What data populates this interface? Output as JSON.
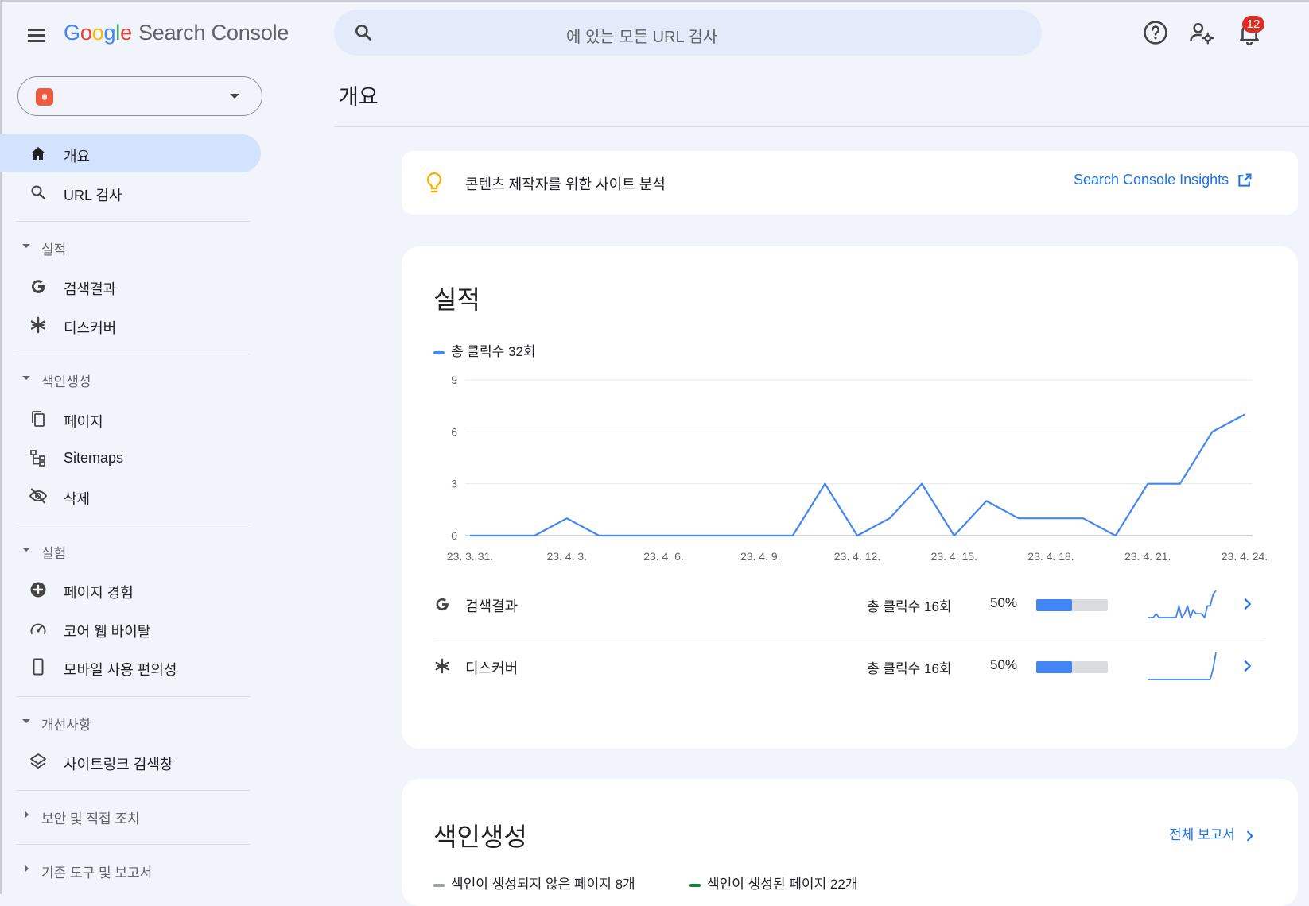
{
  "header": {
    "logo_google": [
      "G",
      "o",
      "o",
      "g",
      "l",
      "e"
    ],
    "logo_product": "Search Console",
    "search_placeholder": "에 있는 모든 URL 검사",
    "notification_count": "12"
  },
  "sidebar": {
    "items": {
      "overview": "개요",
      "url_inspection": "URL 검사",
      "search_results": "검색결과",
      "discover": "디스커버",
      "pages": "페이지",
      "sitemaps": "Sitemaps",
      "removals": "삭제",
      "page_experience": "페이지 경험",
      "core_web_vitals": "코어 웹 바이탈",
      "mobile_usability": "모바일 사용 편의성",
      "sitelinks_searchbox": "사이트링크 검색창"
    },
    "sections": {
      "performance": "실적",
      "indexing": "색인생성",
      "experience": "실험",
      "enhancements": "개선사항",
      "security": "보안 및 직접 조치",
      "legacy": "기존 도구 및 보고서"
    }
  },
  "main": {
    "page_title": "개요",
    "insight": {
      "text": "콘텐츠 제작자를 위한 사이트 분석",
      "link": "Search Console Insights"
    },
    "performance": {
      "title": "실적",
      "legend": "총 클릭수 32회",
      "rows": [
        {
          "name": "검색결과",
          "clicks": "총 클릭수 16회",
          "percent": "50%",
          "share": 0.5
        },
        {
          "name": "디스커버",
          "clicks": "총 클릭수 16회",
          "percent": "50%",
          "share": 0.5
        }
      ]
    },
    "indexing": {
      "title": "색인생성",
      "full_report": "전체 보고서",
      "not_indexed": "색인이 생성되지 않은 페이지 8개",
      "indexed": "색인이 생성된 페이지 22개"
    }
  },
  "colors": {
    "accent": "#1a73e8",
    "series": "#4285f4",
    "not_indexed": "#9aa0a6",
    "indexed": "#188038",
    "active_nav": "#d3e3fd"
  },
  "chart_data": {
    "type": "line",
    "x": [
      "23. 3. 31.",
      "23. 4. 1.",
      "23. 4. 2.",
      "23. 4. 3.",
      "23. 4. 4.",
      "23. 4. 5.",
      "23. 4. 6.",
      "23. 4. 7.",
      "23. 4. 8.",
      "23. 4. 9.",
      "23. 4. 10.",
      "23. 4. 11.",
      "23. 4. 12.",
      "23. 4. 13.",
      "23. 4. 14.",
      "23. 4. 15.",
      "23. 4. 16.",
      "23. 4. 17.",
      "23. 4. 18.",
      "23. 4. 19.",
      "23. 4. 20.",
      "23. 4. 21.",
      "23. 4. 22.",
      "23. 4. 23.",
      "23. 4. 24."
    ],
    "series": [
      {
        "name": "총 클릭수 32회",
        "values": [
          0,
          0,
          0,
          1,
          0,
          0,
          0,
          0,
          0,
          0,
          0,
          3,
          0,
          1,
          3,
          0,
          2,
          1,
          1,
          1,
          0,
          3,
          3,
          6,
          7
        ]
      }
    ],
    "x_tick_labels": [
      "23. 3. 31.",
      "23. 4. 3.",
      "23. 4. 6.",
      "23. 4. 9.",
      "23. 4. 12.",
      "23. 4. 15.",
      "23. 4. 18.",
      "23. 4. 21.",
      "23. 4. 24."
    ],
    "y_ticks": [
      0,
      3,
      6,
      9
    ],
    "ylim": [
      0,
      9
    ],
    "grid": true,
    "title": "",
    "xlabel": "",
    "ylabel": ""
  },
  "sparklines": {
    "search_results": [
      0,
      0,
      0,
      1,
      0,
      0,
      0,
      0,
      0,
      0,
      0,
      3,
      0,
      1,
      3,
      0,
      2,
      1,
      1,
      1,
      0,
      3,
      3,
      6,
      7
    ],
    "discover": [
      0,
      0,
      0,
      0,
      0,
      0,
      0,
      0,
      0,
      0,
      0,
      0,
      0,
      0,
      0,
      0,
      0,
      0,
      0,
      0,
      0,
      0,
      0,
      2,
      5
    ]
  }
}
